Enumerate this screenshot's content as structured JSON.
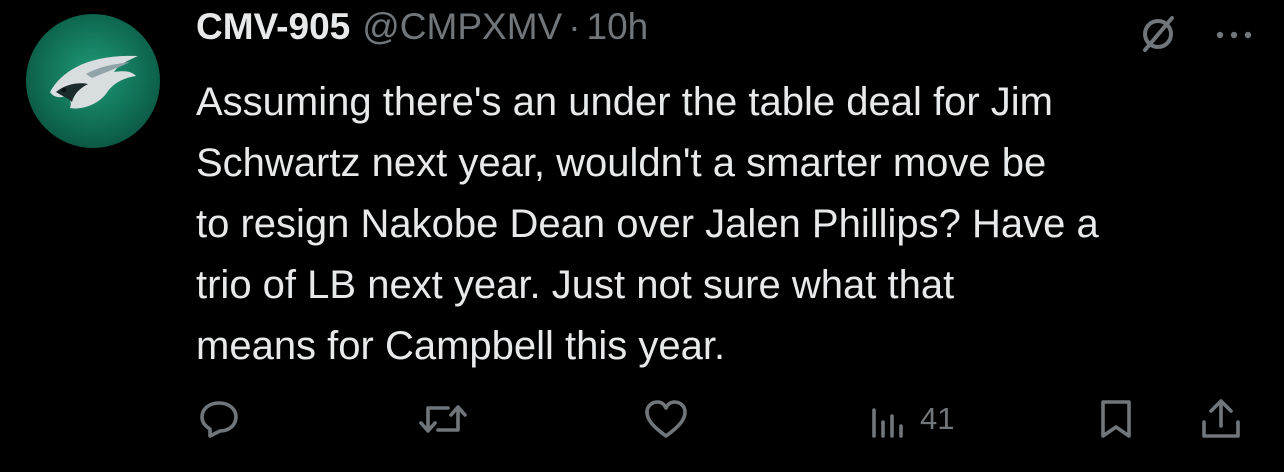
{
  "tweet": {
    "author_name": "CMV-905",
    "handle": "@CMPXMV",
    "separator": "·",
    "time": "10h",
    "text": "Assuming there's an under the table deal for Jim\nSchwartz next year, wouldn't a smarter move be\nto resign Nakobe Dean over Jalen Phillips? Have a\ntrio of LB next year. Just not sure what that\nmeans for Campbell this year.",
    "views_count": "41"
  },
  "icons": {
    "avatar": "eagle-logo",
    "top": [
      "grok-icon",
      "more-icon"
    ],
    "actions": [
      "reply-icon",
      "retweet-icon",
      "like-icon",
      "views-icon",
      "bookmark-icon",
      "share-icon"
    ]
  },
  "colors": {
    "background": "#000000",
    "text_primary": "#e7e9ea",
    "text_secondary": "#71767b",
    "avatar_green": "#1f9a77"
  }
}
